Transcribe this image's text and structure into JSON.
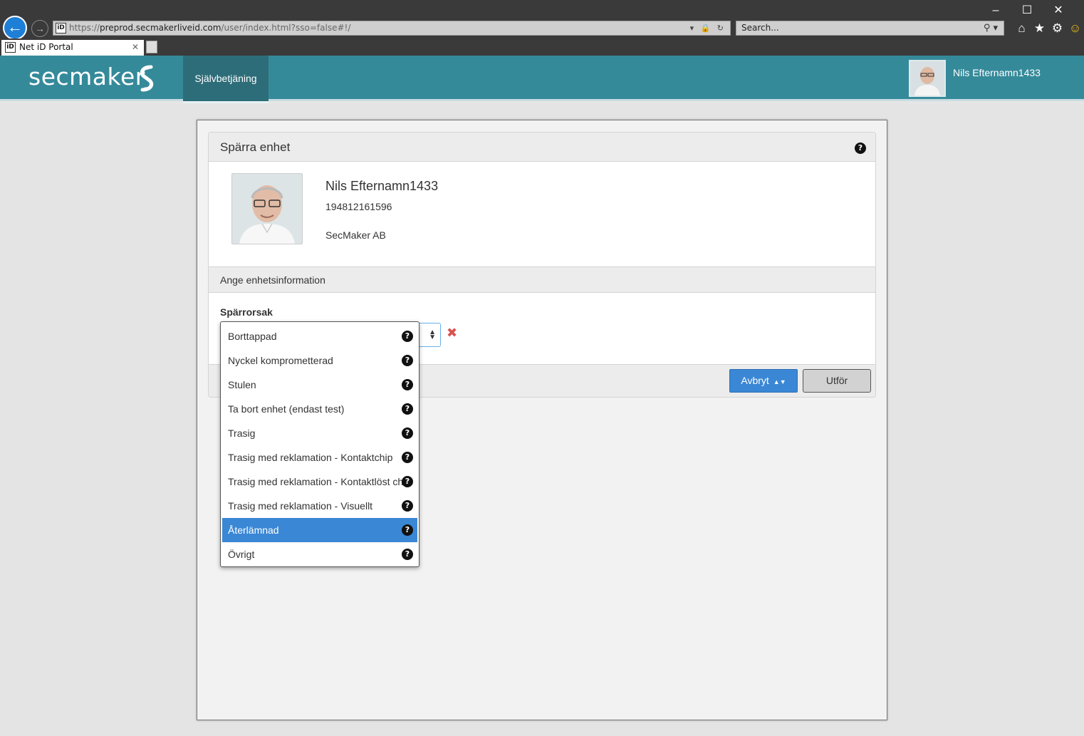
{
  "browser": {
    "url_prefix": "https://",
    "url_host": "preprod.secmakerliveid.com",
    "url_path": "/user/index.html?sso=false#!/",
    "search_placeholder": "Search...",
    "tab_title": "Net iD Portal",
    "favicon_text": "iD"
  },
  "header": {
    "brand": "secmaker",
    "nav_active": "Självbetjäning",
    "user_name": "Nils Efternamn1433"
  },
  "card": {
    "title": "Spärra enhet",
    "help_symbol": "?",
    "profile": {
      "name": "Nils Efternamn1433",
      "id_number": "194812161596",
      "organization": "SecMaker AB"
    },
    "section_title": "Ange enhetsinformation",
    "field_label": "Spärrorsak",
    "clear_symbol": "✖",
    "cancel_label": "Avbryt",
    "submit_label": "Utför"
  },
  "dropdown": {
    "selected_index": 8,
    "options": [
      "Borttappad",
      "Nyckel komprometterad",
      "Stulen",
      "Ta bort enhet (endast test)",
      "Trasig",
      "Trasig med reklamation - Kontaktchip",
      "Trasig med reklamation - Kontaktlöst chip",
      "Trasig med reklamation - Visuellt",
      "Återlämnad",
      "Övrigt"
    ]
  },
  "colors": {
    "header_bg": "#358a9a",
    "nav_active_bg": "#2d6d79",
    "accent_blue": "#3a87d5",
    "clear_red": "#d9534f"
  },
  "icons": {
    "back": "arrow-left-icon",
    "forward": "arrow-right-icon",
    "help": "question-circle-icon",
    "clear": "times-icon",
    "sort": "sort-arrows-icon"
  }
}
